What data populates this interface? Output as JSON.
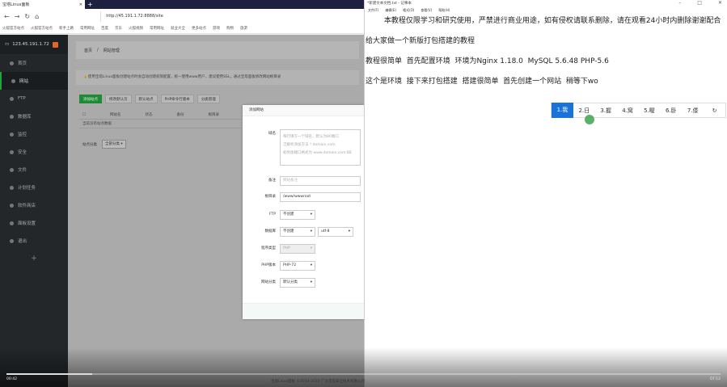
{
  "browser": {
    "tab_title": "宝塔Linux面板",
    "new_tab": "+",
    "url": "http://45.191.1.72:8888/site",
    "bookmarks": [
      "火狐官方站点",
      "火狐官方站点",
      "新手上路",
      "常用网址",
      "百度",
      "京东",
      "火狐视频",
      "常用网址",
      "就业大全",
      "更多站点",
      "游戏",
      "购物",
      "旅游"
    ]
  },
  "panel": {
    "server": "123.45.191.1.72",
    "sidebar": [
      "首页",
      "网站",
      "FTP",
      "数据库",
      "监控",
      "安全",
      "文件",
      "计划任务",
      "软件商店",
      "面板设置",
      "退出"
    ],
    "add": "+",
    "breadcrumb": [
      "首页",
      "网站管理"
    ],
    "notice": "使用宝塔Linux面板创建站点时会自动创建权限配置，统一使用www用户，建议使用SSL，通过宝塔面板修改网站根目录",
    "toolbar": [
      "添加站点",
      "修改默认页",
      "默认站点",
      "PHP命令行版本",
      "分类管理"
    ],
    "table_headers": [
      "网站名",
      "状态",
      "备份",
      "根目录"
    ],
    "empty_text": "当前没有站点数据",
    "category_label": "站点分类",
    "category_value": "全部分类"
  },
  "modal": {
    "title": "添加网站",
    "domain_label": "域名",
    "domain_placeholder": [
      "每行填写一个域名，默认为80端口",
      "泛解析添加方法 *.domain.com",
      "如另加端口格式为 www.domain.com:88"
    ],
    "remark_label": "备注",
    "remark_placeholder": "网站备注",
    "root_label": "根目录",
    "root_value": "/www/wwwroot",
    "ftp_label": "FTP",
    "ftp_value": "不创建",
    "db_label": "数据库",
    "db_value": "不创建",
    "db_charset": "utf-8",
    "type_label": "程序类型",
    "type_value": "PHP",
    "php_label": "PHP版本",
    "php_value": "PHP-72",
    "cat_label": "网站分类",
    "cat_value": "默认分类"
  },
  "notepad": {
    "title": "*新建文本文档.txt - 记事本",
    "menu": [
      "文件(F)",
      "编辑(E)",
      "格式(O)",
      "查看(V)",
      "帮助(H)"
    ],
    "lines": [
      "        本教程仅限学习和研究使用，严禁进行商业用途，如有侵权请联系删除，请在观看24小时内删除谢谢配合",
      "",
      "给大家做一个新版打包搭建的教程",
      "",
      "教程很简单  首先配置环境  环境为Nginx 1.18.0  MySQL 5.6.48 PHP-5.6",
      "",
      "这个是环境  接下来打包搭建  搭建很简单  首先创建一个网站  稍等下wo"
    ],
    "ime_candidates": [
      "1.我",
      "2.日",
      "3.握",
      "4.窝",
      "5.喔",
      "6.卧",
      "7.倭"
    ],
    "ime_refresh": "↻"
  },
  "video": {
    "progress": 0.12,
    "time_left": "00:42",
    "time_right": "07:12"
  },
  "footer": "宝塔Linux面板 ©2014-2020 广东堡塔安全技术有限公司"
}
